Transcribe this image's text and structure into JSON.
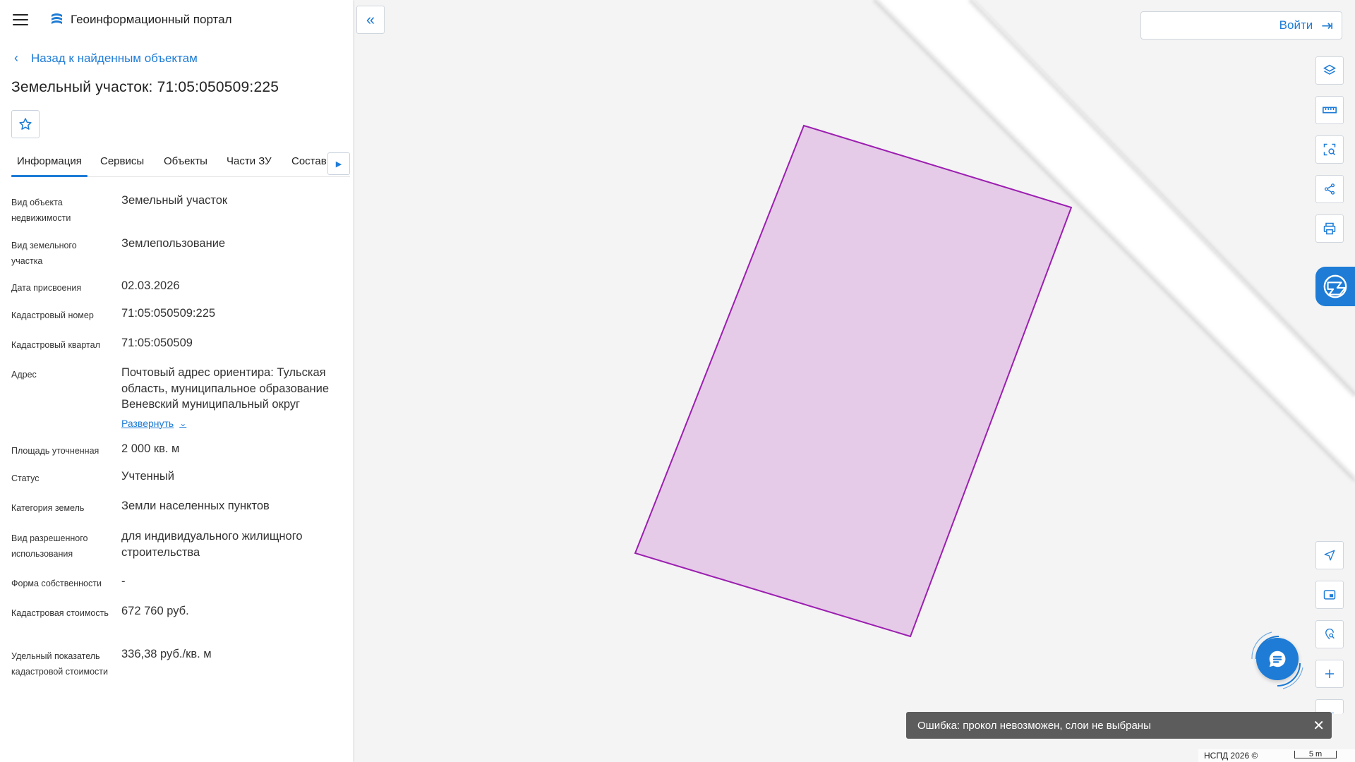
{
  "app": {
    "title": "Геоинформационный портал"
  },
  "nav": {
    "back_label": "Назад к найденным объектам"
  },
  "page": {
    "title": "Земельный участок: 71:05:050509:225"
  },
  "tabs": [
    {
      "label": "Информация",
      "active": true
    },
    {
      "label": "Сервисы"
    },
    {
      "label": "Объекты"
    },
    {
      "label": "Части ЗУ"
    },
    {
      "label": "Состав"
    }
  ],
  "info": {
    "rows": [
      {
        "label": "Вид объекта недвижимости",
        "value": "Земельный участок"
      },
      {
        "label": "Вид земельного участка",
        "value": "Землепользование"
      },
      {
        "label": "Дата присвоения",
        "value": "02.03.2026"
      },
      {
        "label": "Кадастровый номер",
        "value": "71:05:050509:225"
      },
      {
        "label": "Кадастровый квартал",
        "value": "71:05:050509"
      },
      {
        "label": "Адрес",
        "value": "Почтовый адрес ориентира: Тульская область, муниципальное образование Веневский муниципальный округ",
        "expand_label": "Развернуть"
      },
      {
        "label": "Площадь уточненная",
        "value": "2 000 кв. м"
      },
      {
        "label": "Статус",
        "value": "Учтенный"
      },
      {
        "label": "Категория земель",
        "value": "Земли населенных пунктов"
      },
      {
        "label": "Вид разрешенного использования",
        "value": "для индивидуального жилищного строительства"
      },
      {
        "label": "Форма собственности",
        "value": "-"
      },
      {
        "label": "Кадастровая стоимость",
        "value": "672 760 руб."
      },
      {
        "label": "Удельный показатель кадастровой стоимости",
        "value": "336,38 руб./кв. м"
      }
    ]
  },
  "map": {
    "login_label": "Войти",
    "toast": "Ошибка: прокол невозможен, слои не выбраны",
    "copyright": "НСПД 2026 ©",
    "scale_label": "5 m",
    "parcel_color": "#9c1fb0",
    "parcel_fill": "#e5cbe8"
  },
  "colors": {
    "accent": "#1e7cd6"
  }
}
